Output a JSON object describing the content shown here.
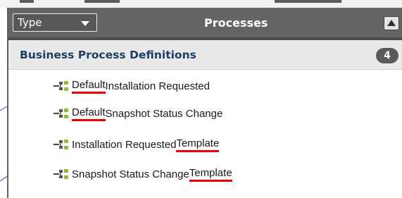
{
  "header": {
    "type_label": "Type",
    "title": "Processes"
  },
  "section": {
    "label": "Business Process Definitions",
    "count": "4"
  },
  "items": [
    {
      "prefix": "",
      "highlight": "Default",
      "suffix": " Installation Requested"
    },
    {
      "prefix": "",
      "highlight": "Default",
      "suffix": " Snapshot Status Change"
    },
    {
      "prefix": "Installation Requested ",
      "highlight": "Template",
      "suffix": ""
    },
    {
      "prefix": "Snapshot Status Change ",
      "highlight": "Template",
      "suffix": ""
    }
  ],
  "colors": {
    "header_bg": "#656565",
    "section_text": "#1f3d66",
    "highlight_underline": "#ee0000",
    "annotation_arrow": "#5b6fd8"
  },
  "icons": {
    "item_icon": "process-definition-icon",
    "dropdown": "chevron-down-icon",
    "collapse": "collapse-up-icon"
  }
}
